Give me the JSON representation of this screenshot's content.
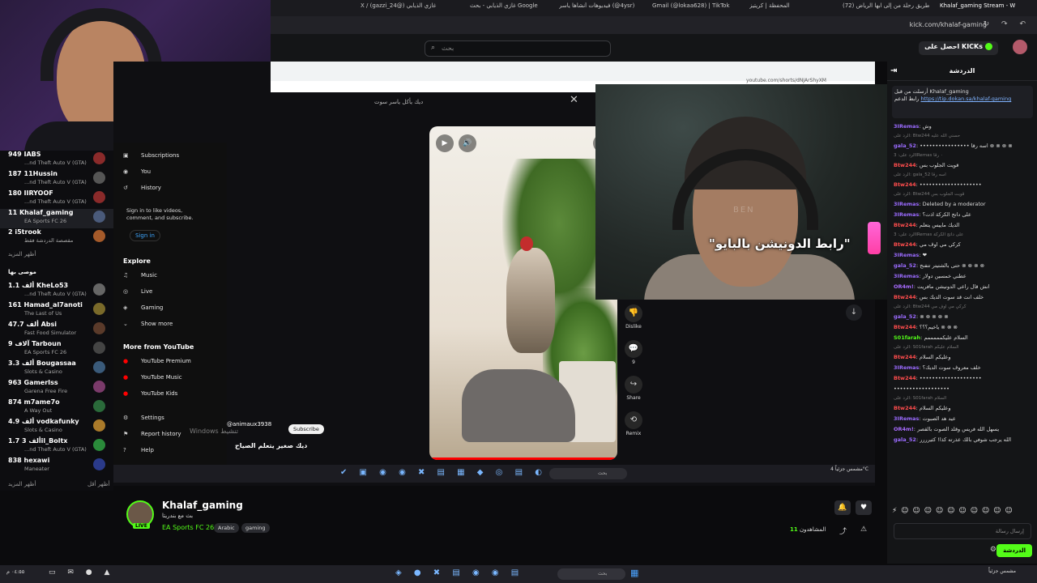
{
  "browser": {
    "tabs": [
      {
        "label": "Khalaf_gaming Stream - W",
        "active": true
      },
      {
        "label": "(72) طريق رحلة من إلى ابها الرياض"
      },
      {
        "label": "المحفظة | كريتيز"
      },
      {
        "label": "Gmail (@lokaa628) | TikTok"
      },
      {
        "label": "فيديوهات أنشأها ياسر (@4ysr)"
      },
      {
        "label": "غازي الذيابي - بحث Google"
      },
      {
        "label": "X / (gazzi_24@) غازي الذيابي"
      }
    ],
    "url": "kick.com/khalaf-gaming"
  },
  "kick_header": {
    "search_placeholder": "بحث",
    "get_kicks": "احصل على KICKs"
  },
  "following": {
    "rows": [
      {
        "count": "949",
        "name": "IABS",
        "game": "...nd Theft Auto V (GTA)",
        "color": "#8a2a2a"
      },
      {
        "count": "187",
        "name": "11Hussin",
        "game": "...nd Theft Auto V (GTA)",
        "color": "#555"
      },
      {
        "count": "180",
        "name": "IIRYOOF",
        "game": "...nd Theft Auto V (GTA)",
        "color": "#8a2a2a"
      },
      {
        "count": "11",
        "name": "Khalaf_gaming",
        "game": "EA Sports FC 26",
        "color": "#4a5a7a",
        "selected": true
      },
      {
        "count": "2",
        "name": "i5trook",
        "game": "مقصصة الدردشة فقط",
        "color": "#a55a2a"
      }
    ],
    "show_more_1": "أظهر المزيد",
    "recommended_heading": "موصى بها",
    "recommended": [
      {
        "count": "1.1 ألف",
        "name": "KheLo53",
        "game": "...nd Theft Auto V (GTA)",
        "color": "#666"
      },
      {
        "count": "161",
        "name": "Hamad_al7anoti",
        "game": "The Last of Us",
        "color": "#7a6a2a"
      },
      {
        "count": "47.7 ألف",
        "name": "Absi",
        "game": "Fast Food Simulator",
        "color": "#5a3a2a"
      },
      {
        "count": "9 آلاف",
        "name": "Tarboun",
        "game": "EA Sports FC 26",
        "color": "#444"
      },
      {
        "count": "3.3 ألف",
        "name": "Bougassaa",
        "game": "Slots & Casino",
        "color": "#3a5a7a"
      },
      {
        "count": "963",
        "name": "GamerIss",
        "game": "Garena Free Fire",
        "color": "#7a3a6a"
      },
      {
        "count": "874",
        "name": "m7ame7o",
        "game": "A Way Out",
        "color": "#2a6a3a"
      },
      {
        "count": "4.9 ألف",
        "name": "vodkafunky",
        "game": "Slots & Casino",
        "color": "#aa7a2a"
      },
      {
        "count": "1.7 ألف",
        "name": "3il_Boltx",
        "game": "...nd Theft Auto V (GTA)",
        "color": "#2a8a3a"
      },
      {
        "count": "838",
        "name": "hexawi",
        "game": "Maneater",
        "color": "#2a3a8a"
      }
    ],
    "show_more_2": "أظهر المزيد",
    "show_less": "أظهر أقل"
  },
  "youtube": {
    "nav": [
      {
        "icon": "subscriptions-icon",
        "glyph": "▣",
        "label": "Subscriptions"
      },
      {
        "icon": "you-icon",
        "glyph": "◉",
        "label": "You"
      },
      {
        "icon": "history-icon",
        "glyph": "↺",
        "label": "History"
      }
    ],
    "signin_text": "Sign in to like videos, comment, and subscribe.",
    "signin_button": "Sign in",
    "explore_heading": "Explore",
    "explore": [
      {
        "icon": "music-icon",
        "glyph": "♫",
        "label": "Music"
      },
      {
        "icon": "live-icon",
        "glyph": "◎",
        "label": "Live"
      },
      {
        "icon": "gaming-icon",
        "glyph": "◈",
        "label": "Gaming"
      },
      {
        "icon": "chevron-down-icon",
        "glyph": "⌄",
        "label": "Show more"
      }
    ],
    "more_heading": "More from YouTube",
    "more": [
      {
        "label": "YouTube Premium"
      },
      {
        "label": "YouTube Music"
      },
      {
        "label": "YouTube Kids"
      }
    ],
    "bottom": [
      {
        "icon": "settings-icon",
        "glyph": "⚙",
        "label": "Settings"
      },
      {
        "icon": "report-icon",
        "glyph": "⚑",
        "label": "Report history"
      },
      {
        "icon": "help-icon",
        "glyph": "?",
        "label": "Help"
      }
    ],
    "inner_url": "youtube.com/shorts/dNJArShyXM",
    "dialog_title": "ديك يأكل ياسر سوت",
    "short_actions": [
      {
        "glyph": "👎",
        "label": "Dislike"
      },
      {
        "glyph": "💬",
        "label": "9"
      },
      {
        "glyph": "↪",
        "label": "Share"
      },
      {
        "glyph": "⟲",
        "label": "Remix"
      }
    ],
    "channel_handle": "@animaux3938",
    "subscribe": "Subscribe",
    "caption": "ديك صغير يتعلم الصياح",
    "watermark": "Windows تنشيط",
    "weather": "مشمس جزئياً 4°C"
  },
  "guest": {
    "subtitle": "\"رابط الدونيشن بالبايو\"",
    "brand": "BEN"
  },
  "channel": {
    "name": "Khalaf_gaming",
    "live": "LIVE",
    "title": "بث مع بندريتا",
    "category": "EA Sports FC 26",
    "tags": [
      "Arabic",
      "gaming"
    ],
    "viewers_label": "المشاهدون",
    "viewers_count": "11"
  },
  "chat": {
    "title": "الدردشة",
    "pinned_by": "أرسلت من قبل Khalaf_gaming",
    "pinned_prefix": "رابط الدعم",
    "pinned_link": "https://tip.dokan.sa/khalaf-gaming",
    "messages": [
      {
        "user": "3IRemas",
        "color": "#9b6bff",
        "text": "وش"
      },
      {
        "reply": "الرد على: Btw244 حسني الله عليه"
      },
      {
        "user": "gala_52",
        "color": "#9b6bff",
        "text": "•••••••••••••••• اسه رقا ⊗ ⊗ ⊗ ⊗"
      },
      {
        "reply": "الرد على: 3IRemas ٠ رقا"
      },
      {
        "user": "Btw244",
        "color": "#ff4d4d",
        "text": "قويت الجلوب بس"
      },
      {
        "reply": "الرد على: gala_52 اسه رقا"
      },
      {
        "user": "Btw244",
        "color": "#ff4d4d",
        "text": "••••••••••••••••••••"
      },
      {
        "reply": "الرد على: Btw244 قويت الجلوب بس"
      },
      {
        "user": "3IRemas",
        "color": "#9b6bff",
        "text": "Deleted by a moderator"
      },
      {
        "user": "3IRemas",
        "color": "#9b6bff",
        "text": "على داتج الكركة اذت؟"
      },
      {
        "user": "Btw244",
        "color": "#ff4d4d",
        "text": "الديك ماييس يتعلم"
      },
      {
        "reply": "الرد على: 3IRemas على داتج الكركة"
      },
      {
        "user": "Btw244",
        "color": "#ff4d4d",
        "text": "كركي مي اوف مي"
      },
      {
        "user": "3IRemas",
        "color": "#9b6bff",
        "text": "❤"
      },
      {
        "user": "gala_52",
        "color": "#9b6bff",
        "text": "حتى بالشتيتر تتفنج ⊗ ⊗ ⊗ ⊗"
      },
      {
        "user": "3IRemas",
        "color": "#9b6bff",
        "text": "عطني خمسين دولار"
      },
      {
        "user": "OR4m!",
        "color": "#a86bff",
        "text": "انش قال راعي الدونيشن مافريت"
      },
      {
        "user": "Btw244",
        "color": "#ff4d4d",
        "text": "خلف انت قد سوت الديك بس"
      },
      {
        "reply": "الرد على: Btw244 كركي مي اوف مي"
      },
      {
        "user": "gala_52",
        "color": "#9b6bff",
        "text": "⊗ ⊗ ⊗ ⊗ ⊗"
      },
      {
        "user": "Btw244",
        "color": "#ff4d4d",
        "text": "ياخيم؟؟؟ ⊗ ⊗ ⊗"
      },
      {
        "user": "S01farah",
        "color": "#53fc18",
        "text": "السلام عليكمممممم"
      },
      {
        "reply": "الرد على: S01farah السلام عليكم"
      },
      {
        "user": "Btw244",
        "color": "#ff4d4d",
        "text": "وعليكم السلام"
      },
      {
        "user": "3IRemas",
        "color": "#9b6bff",
        "text": "خلف معروف سوت الديك؟"
      },
      {
        "user": "Btw244",
        "color": "#ff4d4d",
        "text": "••••••••••••••••••••"
      },
      {
        "user": "",
        "color": "#ddd",
        "text": "••••••••••••••••••"
      },
      {
        "reply": "الرد على: S01farah السلام"
      },
      {
        "user": "Btw244",
        "color": "#ff4d4d",
        "text": "وعليكم السلام"
      },
      {
        "user": "3IRemas",
        "color": "#9b6bff",
        "text": "عيد هد الصبوت"
      },
      {
        "user": "OR4m!",
        "color": "#a86bff",
        "text": "يسهل الله فريس وقلد الصوت بالقصر"
      },
      {
        "user": "gala_52",
        "color": "#9b6bff",
        "text": "الله يرجب شوفي بالك عذرته كذا! كثيرررر"
      }
    ],
    "emotes": "⚡ ☺ ☺ ☺ ☺ ☺ ☺ ☺ ☺ ☺ ☺",
    "input_placeholder": "إرسال رسالة",
    "send": "الدردشة"
  },
  "taskbar": {
    "time": "٠٤:٥٥ م",
    "weather": "مشمس جزئياً"
  }
}
